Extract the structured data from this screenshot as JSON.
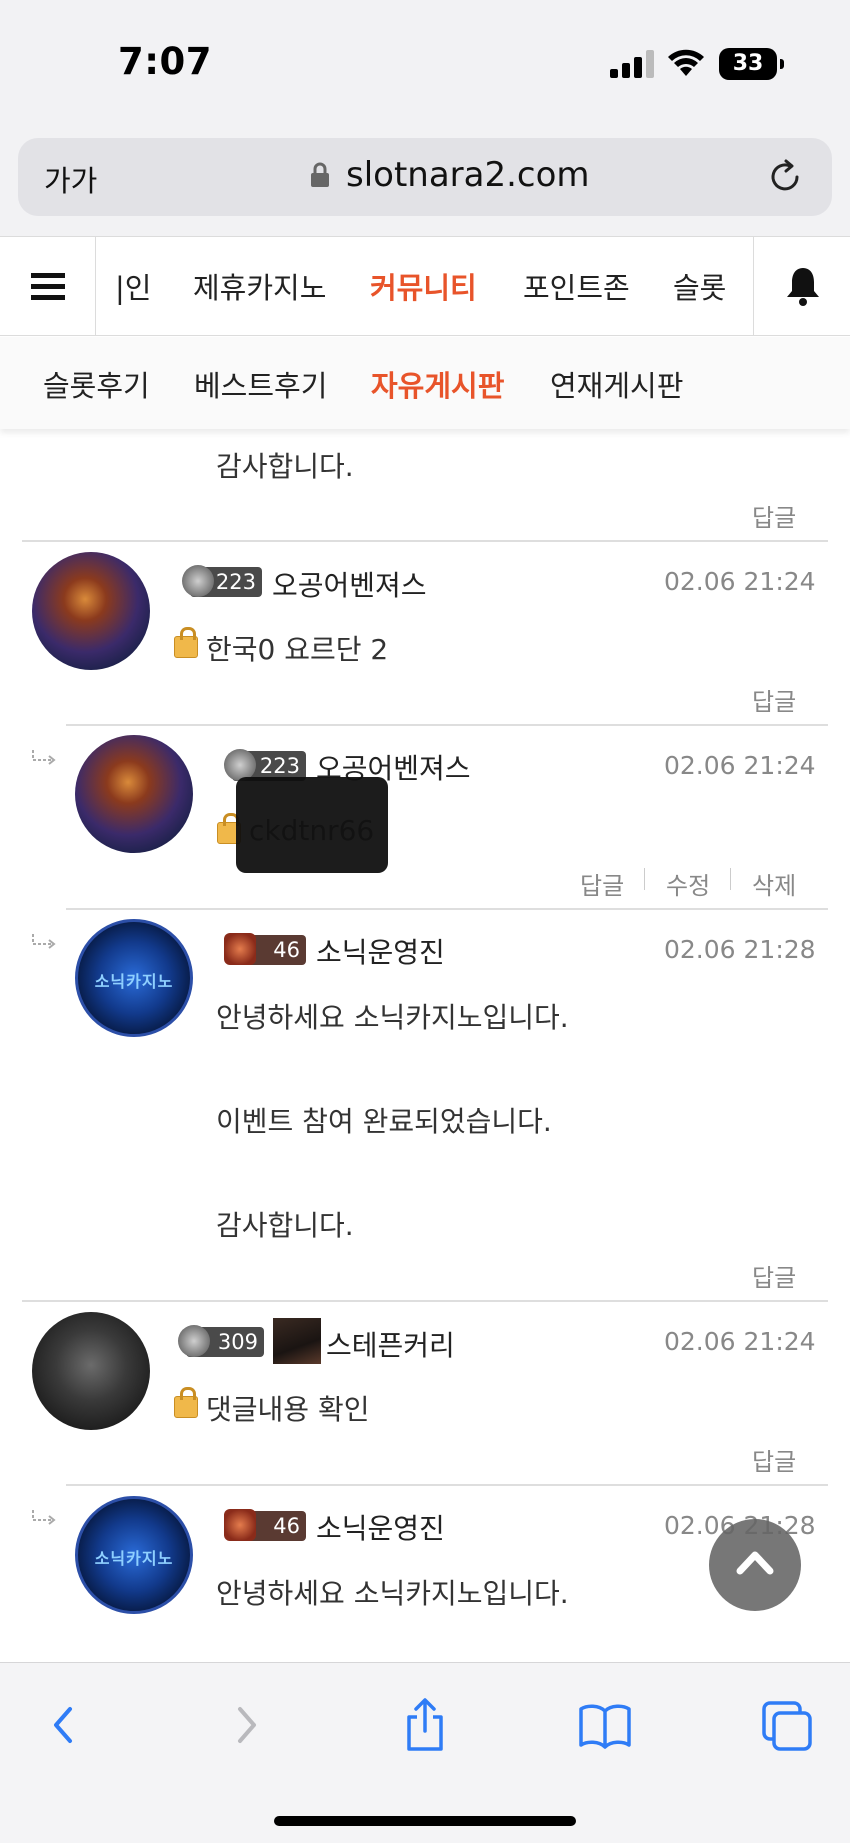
{
  "status_bar": {
    "time": "7:07",
    "battery": "33"
  },
  "browser": {
    "text_size_label": "가가",
    "url": "slotnara2.com"
  },
  "site_nav": {
    "items": [
      "|인",
      "제휴카지노",
      "커뮤니티",
      "포인트존",
      "슬롯"
    ],
    "active": "커뮤니티"
  },
  "sub_nav": {
    "items": [
      "슬롯후기",
      "베스트후기",
      "자유게시판",
      "연재게시판"
    ],
    "active": "자유게시판"
  },
  "comments": {
    "top_fragment": {
      "text": "감사합니다.",
      "reply": "답글"
    },
    "c1": {
      "level": "223",
      "author": "오공어벤져스",
      "date": "02.06 21:24",
      "text": "한국0 요르단 2",
      "reply": "답글"
    },
    "c2": {
      "level": "223",
      "author": "오공어벤져스",
      "date": "02.06 21:24",
      "text": "ckdtnr66",
      "reply": "답글",
      "edit": "수정",
      "delete": "삭제"
    },
    "c3": {
      "level": "46",
      "author": "소닉운영진",
      "date": "02.06 21:28",
      "avatar_text": "소닉카지노",
      "line1": "안녕하세요 소닉카지노입니다.",
      "line2": "이벤트 참여 완료되었습니다.",
      "line3": "감사합니다.",
      "reply": "답글"
    },
    "c4": {
      "level": "309",
      "author": "스테픈커리",
      "date": "02.06 21:24",
      "text": "댓글내용 확인",
      "reply": "답글"
    },
    "c5": {
      "level": "46",
      "author": "소닉운영진",
      "date": "02.06 21:28",
      "avatar_text": "소닉카지노",
      "line1": "안녕하세요 소닉카지노입니다."
    }
  },
  "colors": {
    "accent": "#e8542a",
    "ios_blue": "#2f7cf6"
  },
  "icons": [
    "hamburger-icon",
    "bell-icon",
    "lock-icon",
    "reload-icon",
    "back-icon",
    "forward-icon",
    "share-icon",
    "bookmarks-icon",
    "tabs-icon",
    "chevron-up-icon"
  ]
}
